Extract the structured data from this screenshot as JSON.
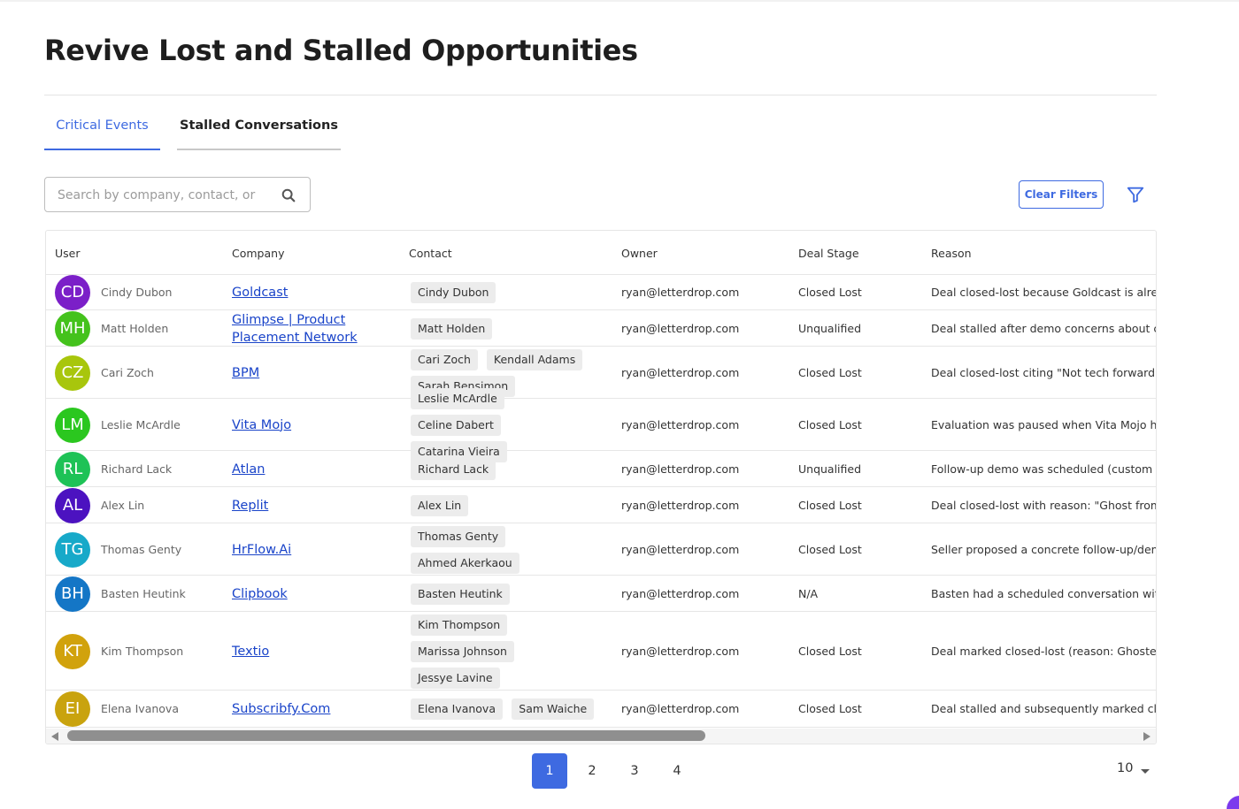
{
  "page": {
    "title": "Revive Lost and Stalled Opportunities"
  },
  "tabs": [
    {
      "label": "Critical Events",
      "active": true
    },
    {
      "label": "Stalled Conversations",
      "active": false
    }
  ],
  "search": {
    "placeholder": "Search by company, contact, or",
    "value": "",
    "icon": "search-icon"
  },
  "toolbar": {
    "clear_filters_label": "Clear Filters",
    "filter_icon": "filter-icon"
  },
  "table": {
    "columns": [
      "User",
      "Company",
      "Contact",
      "Owner",
      "Deal Stage",
      "Reason"
    ],
    "rows": [
      {
        "initials": "CD",
        "avatar_color": "#7b1fc8",
        "user": "Cindy Dubon",
        "company_lines": [
          "Goldcast"
        ],
        "contacts": [
          "Cindy Dubon"
        ],
        "owner": "ryan@letterdrop.com",
        "stage": "Closed Lost",
        "reason": "Deal closed-lost because Goldcast is alread"
      },
      {
        "initials": "MH",
        "avatar_color": "#44c21c",
        "user": "Matt Holden",
        "company_lines": [
          "Glimpse | Product",
          "Placement Network"
        ],
        "contacts": [
          "Matt Holden"
        ],
        "owner": "ryan@letterdrop.com",
        "stage": "Unqualified",
        "reason": "Deal stalled after demo concerns about cos"
      },
      {
        "initials": "CZ",
        "avatar_color": "#a8c60c",
        "user": "Cari Zoch",
        "company_lines": [
          "BPM"
        ],
        "contacts": [
          "Cari Zoch",
          "Kendall Adams",
          "Sarah Bensimon"
        ],
        "owner": "ryan@letterdrop.com",
        "stage": "Closed Lost",
        "reason": "Deal closed-lost citing \"Not tech forward - "
      },
      {
        "initials": "LM",
        "avatar_color": "#2bc71f",
        "user": "Leslie McArdle",
        "company_lines": [
          "Vita Mojo"
        ],
        "contacts": [
          "Leslie McArdle",
          "Celine Dabert",
          "Catarina Vieira"
        ],
        "owner": "ryan@letterdrop.com",
        "stage": "Closed Lost",
        "reason": "Evaluation was paused when Vita Mojo hire"
      },
      {
        "initials": "RL",
        "avatar_color": "#1ec256",
        "user": "Richard Lack",
        "company_lines": [
          "Atlan"
        ],
        "contacts": [
          "Richard Lack"
        ],
        "owner": "ryan@letterdrop.com",
        "stage": "Unqualified",
        "reason": "Follow-up demo was scheduled (custom d"
      },
      {
        "initials": "AL",
        "avatar_color": "#4c12c0",
        "user": "Alex Lin",
        "company_lines": [
          "Replit"
        ],
        "contacts": [
          "Alex Lin"
        ],
        "owner": "ryan@letterdrop.com",
        "stage": "Closed Lost",
        "reason": "Deal closed-lost with reason: \"Ghost from R"
      },
      {
        "initials": "TG",
        "avatar_color": "#17a9c9",
        "user": "Thomas Genty",
        "company_lines": [
          "HrFlow.Ai"
        ],
        "contacts": [
          "Thomas Genty",
          "Ahmed Akerkaou"
        ],
        "owner": "ryan@letterdrop.com",
        "stage": "Closed Lost",
        "reason": "Seller proposed a concrete follow-up/dem"
      },
      {
        "initials": "BH",
        "avatar_color": "#1476c6",
        "user": "Basten Heutink",
        "company_lines": [
          "Clipbook"
        ],
        "contacts": [
          "Basten Heutink"
        ],
        "owner": "ryan@letterdrop.com",
        "stage": "N/A",
        "reason": "Basten had a scheduled conversation with"
      },
      {
        "initials": "KT",
        "avatar_color": "#d1a20c",
        "user": "Kim Thompson",
        "company_lines": [
          "Textio"
        ],
        "contacts": [
          "Kim Thompson",
          "Marissa Johnson",
          "Jessye Lavine"
        ],
        "owner": "ryan@letterdrop.com",
        "stage": "Closed Lost",
        "reason": "Deal marked closed-lost (reason: Ghosted"
      },
      {
        "initials": "EI",
        "avatar_color": "#c9a30e",
        "user": "Elena Ivanova",
        "company_lines": [
          "Subscribfy.Com"
        ],
        "contacts": [
          "Elena Ivanova",
          "Sam Waiche"
        ],
        "owner": "ryan@letterdrop.com",
        "stage": "Closed Lost",
        "reason": "Deal stalled and subsequently marked clos"
      }
    ]
  },
  "pagination": {
    "pages": [
      "1",
      "2",
      "3",
      "4"
    ],
    "current": "1",
    "page_size": "10"
  },
  "colors": {
    "accent": "#3e6ae1",
    "link": "#1a44c9"
  }
}
